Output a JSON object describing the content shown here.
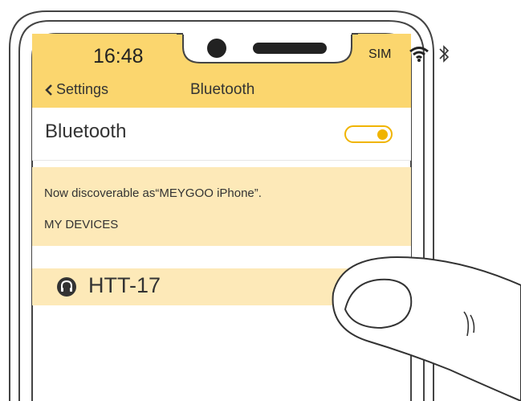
{
  "status_bar": {
    "time": "16:48",
    "carrier": "SIM"
  },
  "nav": {
    "back_label": "Settings",
    "title": "Bluetooth"
  },
  "bluetooth_row": {
    "label": "Bluetooth",
    "toggle_on": true
  },
  "discoverable_text": "Now discoverable  as“MEYGOO iPhone”.",
  "section_header": "MY DEVICES",
  "devices": [
    {
      "name": "HTT-17",
      "icon": "headphones-icon"
    }
  ],
  "colors": {
    "accent_bar": "#fbd66e",
    "info_bg": "#fde9b8",
    "toggle": "#f0b400"
  }
}
